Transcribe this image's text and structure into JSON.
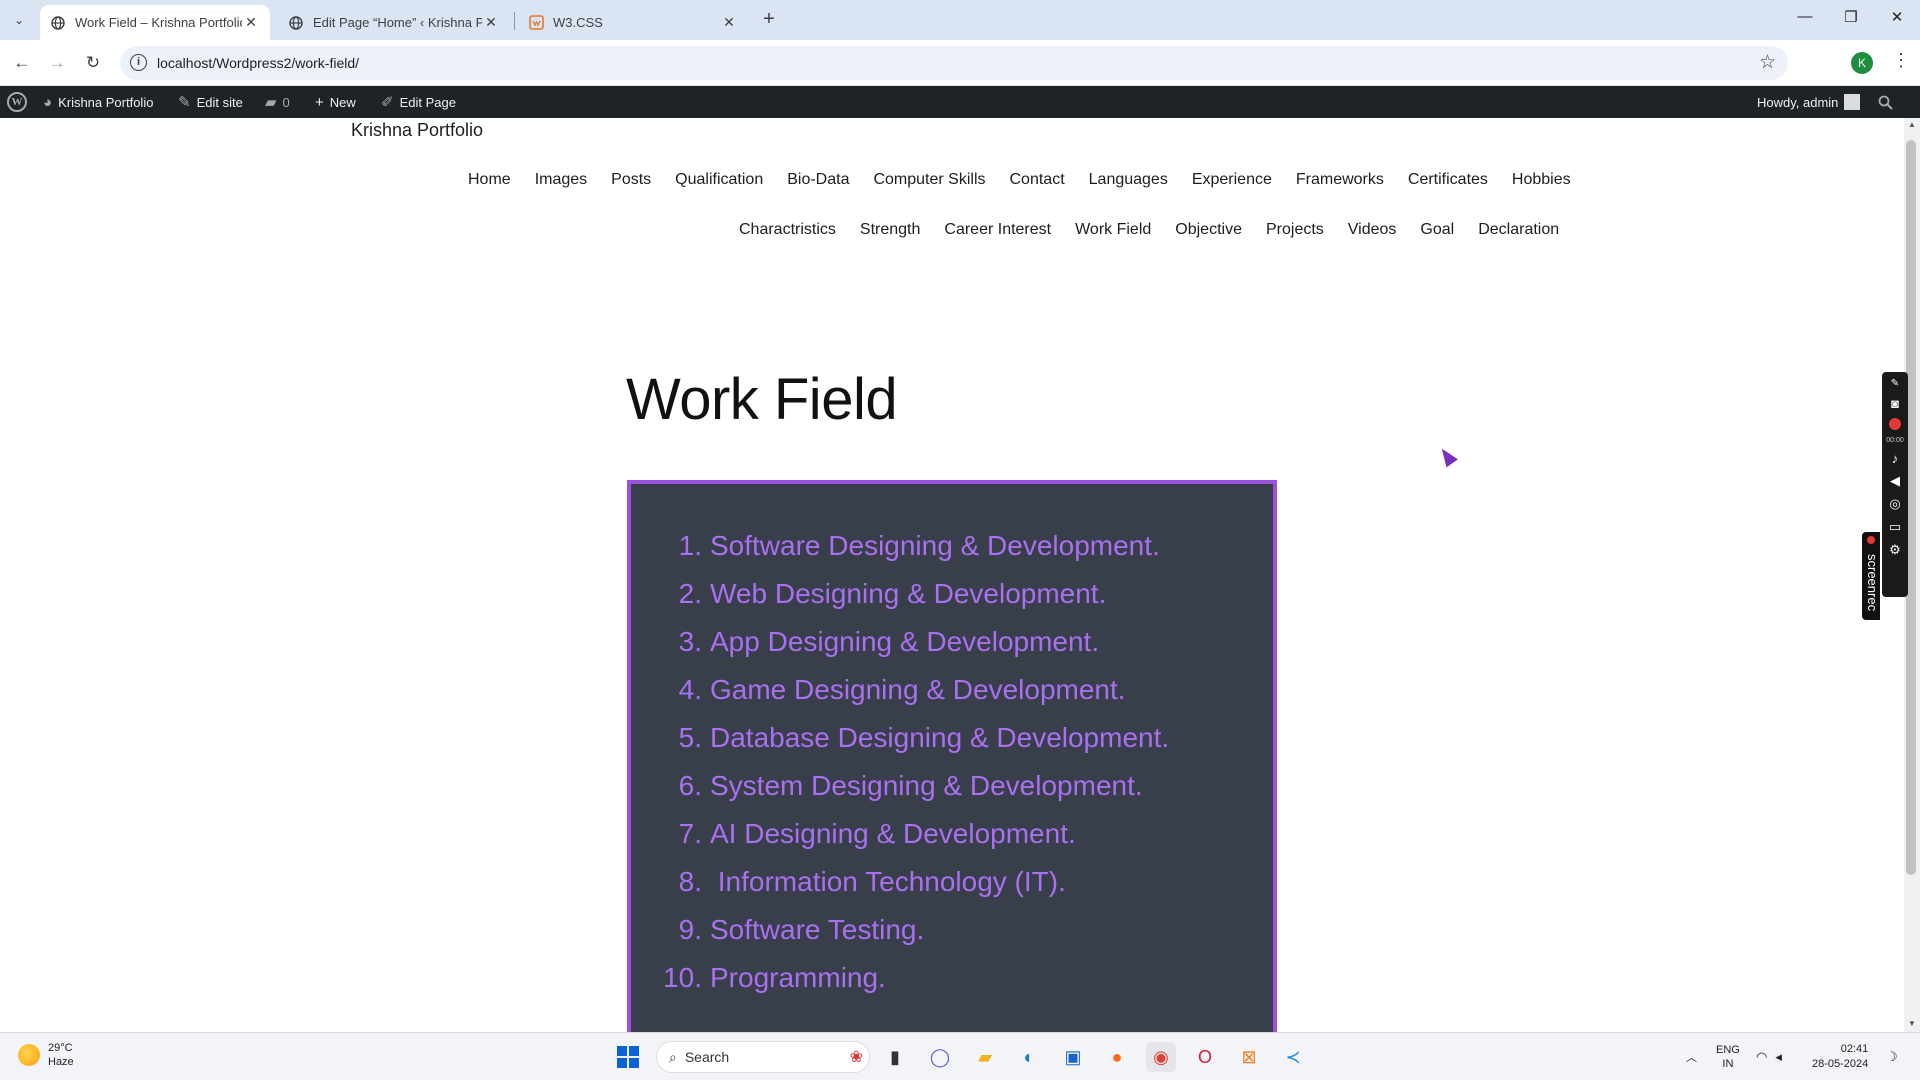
{
  "browser": {
    "tabs": [
      {
        "title": "Work Field – Krishna Portfolio",
        "active": true
      },
      {
        "title": "Edit Page “Home” ‹ Krishna Por",
        "active": false
      },
      {
        "title": "W3.CSS",
        "active": false
      }
    ],
    "url": "localhost/Wordpress2/work-field/",
    "profile_initial": "K"
  },
  "adminbar": {
    "site_name": "Krishna Portfolio",
    "edit_site": "Edit site",
    "comments_count": "0",
    "new_label": "New",
    "edit_page": "Edit Page",
    "howdy": "Howdy, admin"
  },
  "site": {
    "title": "Krishna Portfolio",
    "menu_row1": [
      "Home",
      "Images",
      "Posts",
      "Qualification",
      "Bio-Data",
      "Computer Skills",
      "Contact",
      "Languages",
      "Experience",
      "Frameworks",
      "Certificates",
      "Hobbies"
    ],
    "menu_row2": [
      "Charactristics",
      "Strength",
      "Career Interest",
      "Work Field",
      "Objective",
      "Projects",
      "Videos",
      "Goal",
      "Declaration"
    ]
  },
  "page": {
    "heading": "Work Field",
    "work_items": [
      {
        "num": "1.",
        "text": "Software Designing & Development."
      },
      {
        "num": "2.",
        "text": "Web Designing & Development."
      },
      {
        "num": "3.",
        "text": "App Designing & Development."
      },
      {
        "num": "4.",
        "text": "Game Designing & Development."
      },
      {
        "num": "5.",
        "text": "Database Designing & Development."
      },
      {
        "num": "6.",
        "text": "System Designing & Development."
      },
      {
        "num": "7.",
        "text": "AI Designing & Development."
      },
      {
        "num": "8.",
        "text": " Information Technology (IT)."
      },
      {
        "num": "9.",
        "text": "Software Testing."
      },
      {
        "num": "10.",
        "text": "Programming."
      }
    ]
  },
  "screenrec": {
    "label": "screenrec",
    "time": "00:00"
  },
  "taskbar": {
    "temperature": "29°C",
    "condition": "Haze",
    "search_placeholder": "Search",
    "language": "ENG",
    "region": "IN",
    "time": "02:41",
    "date": "28-05-2024"
  },
  "colors": {
    "accent": "#9b51e0",
    "list_text": "#a970f0",
    "box_background": "#383e4a",
    "admin_bar": "#1d2327"
  }
}
